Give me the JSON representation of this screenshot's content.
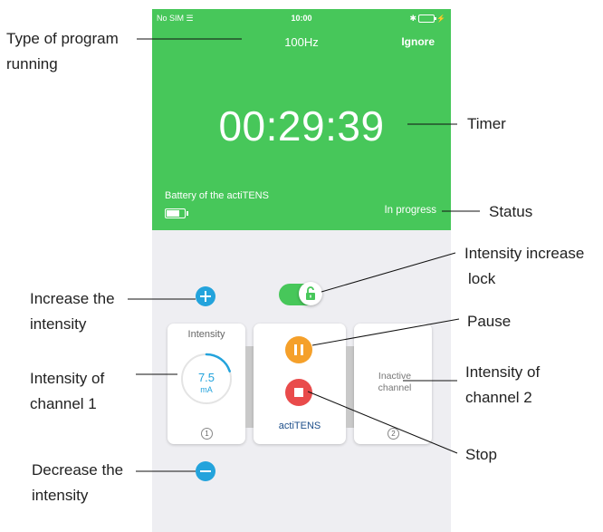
{
  "status_bar": {
    "carrier": "No SIM",
    "time": "10:00"
  },
  "header": {
    "program": "100Hz",
    "ignore_label": "Ignore",
    "timer": "00:29:39"
  },
  "device": {
    "battery_label": "Battery of the actiTENS",
    "status": "In progress"
  },
  "channel1": {
    "title": "Intensity",
    "value": "7.5",
    "unit": "mA",
    "number": "1",
    "level_fraction": 0.2
  },
  "center": {
    "brand": "actiTENS"
  },
  "channel2": {
    "text": "Inactive channel",
    "number": "2"
  },
  "annotations": {
    "program_l1": "Type of program",
    "program_l2": "running",
    "timer": "Timer",
    "status": "Status",
    "lock_l1": "Intensity increase",
    "lock_l2": "lock",
    "increase_l1": "Increase the",
    "increase_l2": "intensity",
    "pause": "Pause",
    "ch1_l1": "Intensity  of",
    "ch1_l2": "channel 1",
    "ch2_l1": "Intensity of",
    "ch2_l2": "channel  2",
    "stop": "Stop",
    "decrease_l1": "Decrease the",
    "decrease_l2": "intensity"
  },
  "colors": {
    "green": "#47c75a",
    "blue": "#23a3dc",
    "orange": "#f5a02a",
    "red": "#e94b4b",
    "background": "#eeeef2"
  }
}
